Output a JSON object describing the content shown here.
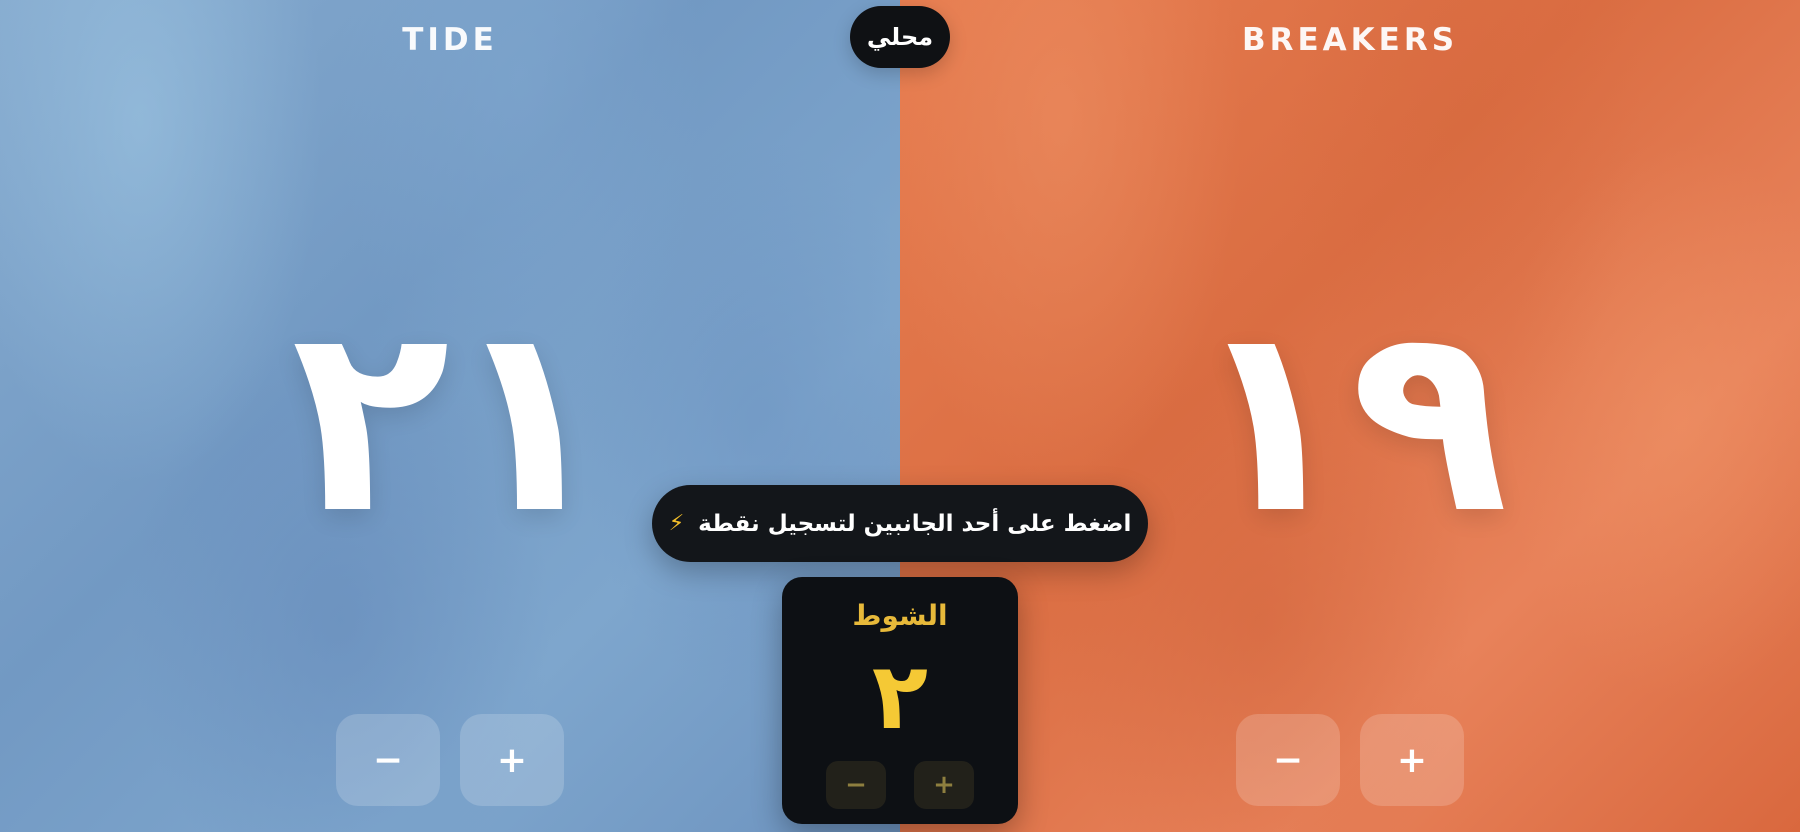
{
  "mode": {
    "label": "محلي"
  },
  "hint": {
    "text": "اضغط على أحد الجانبين لتسجيل نقطة",
    "icon": "lightning-bolt-icon"
  },
  "teams": [
    {
      "name": "TIDE",
      "score": "٢١",
      "minus_label": "−",
      "plus_label": "+",
      "color": "#7ea6cd"
    },
    {
      "name": "BREAKERS",
      "score": "١٩",
      "minus_label": "−",
      "plus_label": "+",
      "color": "#e07548"
    }
  ],
  "set": {
    "label": "الشوط",
    "value": "٢",
    "minus_label": "−",
    "plus_label": "+",
    "accent": "#f5c935"
  }
}
